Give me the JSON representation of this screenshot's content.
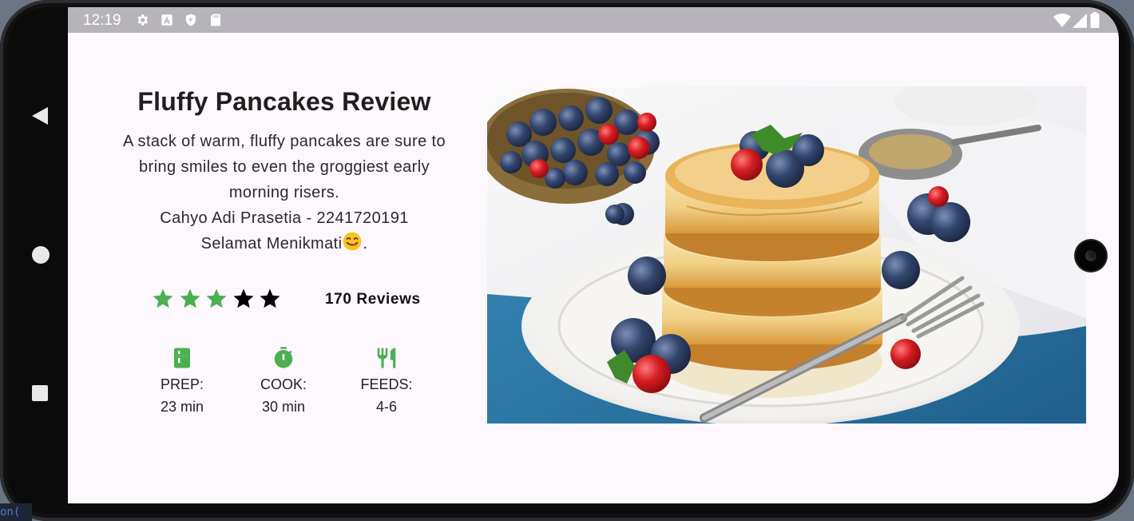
{
  "status_bar": {
    "time": "12:19",
    "left_icons": [
      "settings-icon",
      "a-box-icon",
      "shield-play-icon",
      "sd-card-icon"
    ],
    "right_icons": [
      "wifi-icon",
      "signal-icon",
      "battery-icon"
    ]
  },
  "navigation": {
    "back": "back-triangle-icon",
    "home": "home-circle-icon",
    "recents": "recents-square-icon"
  },
  "recipe": {
    "title": "Fluffy Pancakes Review",
    "description_lines": [
      "A stack of warm, fluffy pancakes are sure to",
      "bring smiles to even the groggiest early",
      "morning risers."
    ],
    "author": "Cahyo Adi Prasetia - 2241720191",
    "greeting": "Selamat Menikmati",
    "greeting_suffix": ".",
    "rating": 3,
    "rating_max": 5,
    "reviews": "170 Reviews",
    "info": [
      {
        "icon": "kitchen-icon",
        "label": "PREP:",
        "value": "23 min"
      },
      {
        "icon": "timer-icon",
        "label": "COOK:",
        "value": "30 min"
      },
      {
        "icon": "restaurant-icon",
        "label": "FEEDS:",
        "value": "4-6"
      }
    ],
    "image": "pancakes-with-blueberries-photo"
  },
  "colors": {
    "accent_green": "#4caf50",
    "screen_bg": "#fdf7fe",
    "status_bar_bg": "#b7b3ba"
  },
  "corner_code": "on("
}
